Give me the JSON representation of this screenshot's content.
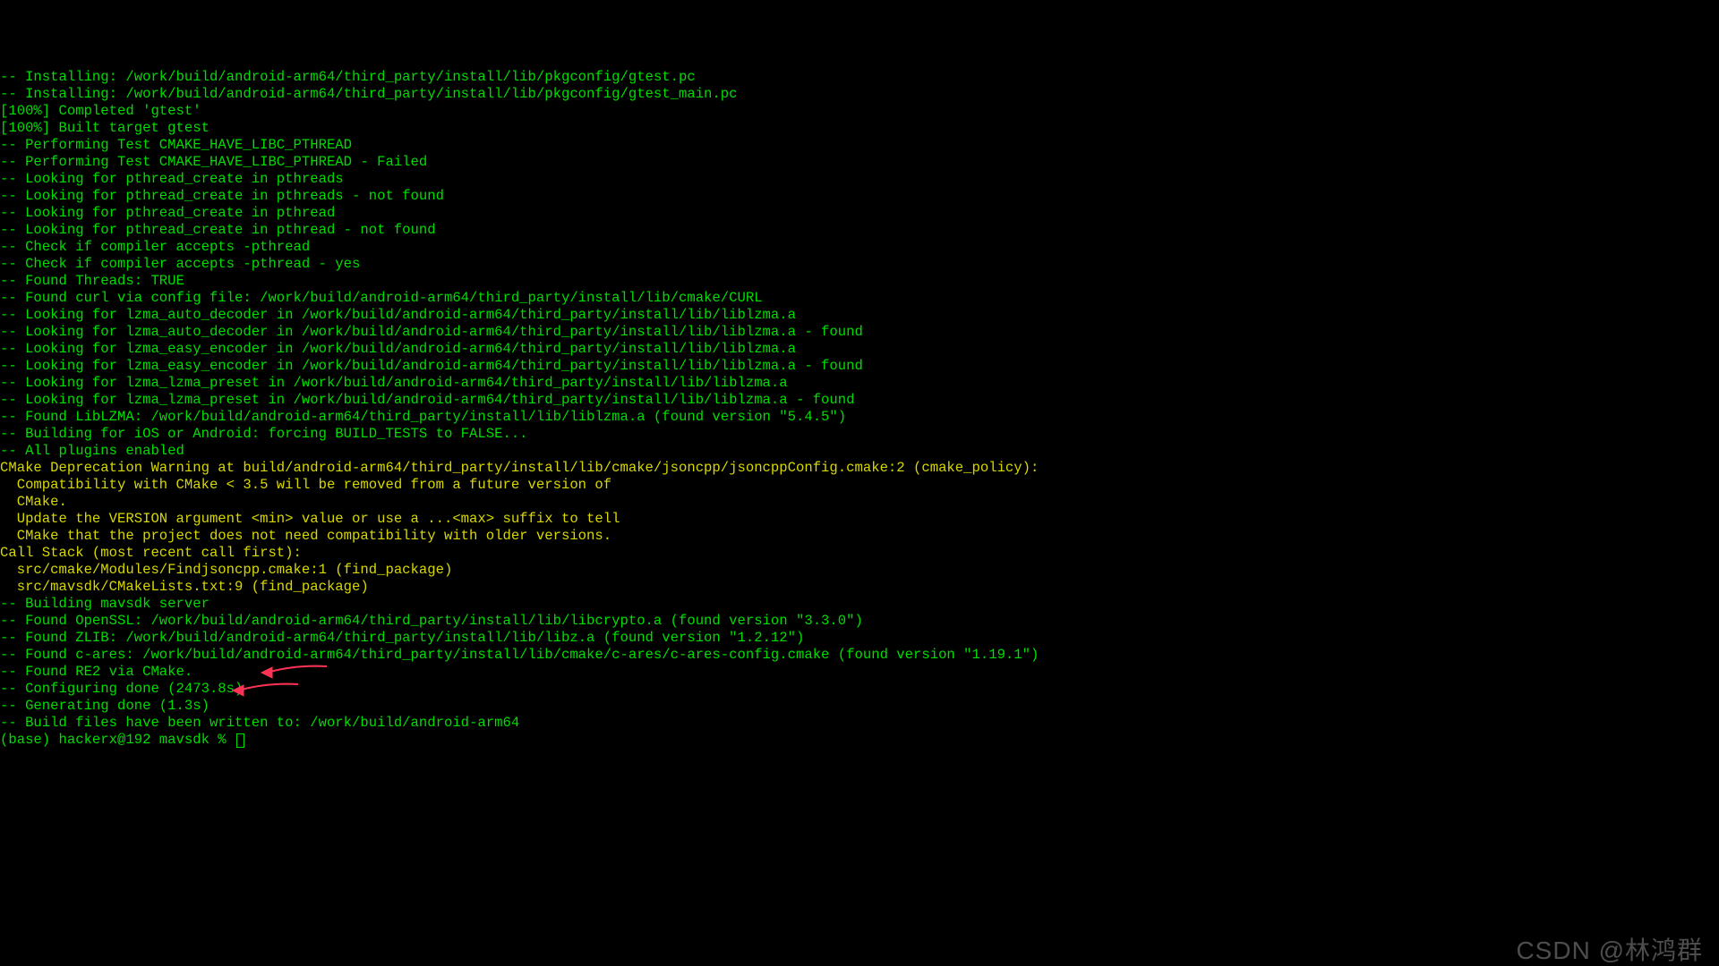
{
  "lines": [
    "-- Installing: /work/build/android-arm64/third_party/install/lib/pkgconfig/gtest.pc",
    "-- Installing: /work/build/android-arm64/third_party/install/lib/pkgconfig/gtest_main.pc",
    "[100%] Completed 'gtest'",
    "[100%] Built target gtest",
    "-- Performing Test CMAKE_HAVE_LIBC_PTHREAD",
    "-- Performing Test CMAKE_HAVE_LIBC_PTHREAD - Failed",
    "-- Looking for pthread_create in pthreads",
    "-- Looking for pthread_create in pthreads - not found",
    "-- Looking for pthread_create in pthread",
    "-- Looking for pthread_create in pthread - not found",
    "-- Check if compiler accepts -pthread",
    "-- Check if compiler accepts -pthread - yes",
    "-- Found Threads: TRUE",
    "-- Found curl via config file: /work/build/android-arm64/third_party/install/lib/cmake/CURL",
    "-- Looking for lzma_auto_decoder in /work/build/android-arm64/third_party/install/lib/liblzma.a",
    "-- Looking for lzma_auto_decoder in /work/build/android-arm64/third_party/install/lib/liblzma.a - found",
    "-- Looking for lzma_easy_encoder in /work/build/android-arm64/third_party/install/lib/liblzma.a",
    "-- Looking for lzma_easy_encoder in /work/build/android-arm64/third_party/install/lib/liblzma.a - found",
    "-- Looking for lzma_lzma_preset in /work/build/android-arm64/third_party/install/lib/liblzma.a",
    "-- Looking for lzma_lzma_preset in /work/build/android-arm64/third_party/install/lib/liblzma.a - found",
    "-- Found LibLZMA: /work/build/android-arm64/third_party/install/lib/liblzma.a (found version \"5.4.5\")",
    "-- Building for iOS or Android: forcing BUILD_TESTS to FALSE...",
    "-- All plugins enabled"
  ],
  "warn": [
    "CMake Deprecation Warning at build/android-arm64/third_party/install/lib/cmake/jsoncpp/jsoncppConfig.cmake:2 (cmake_policy):",
    "  Compatibility with CMake < 3.5 will be removed from a future version of",
    "  CMake.",
    "",
    "  Update the VERSION argument <min> value or use a ...<max> suffix to tell",
    "  CMake that the project does not need compatibility with older versions.",
    "Call Stack (most recent call first):",
    "  src/cmake/Modules/Findjsoncpp.cmake:1 (find_package)",
    "  src/mavsdk/CMakeLists.txt:9 (find_package)",
    "",
    ""
  ],
  "post": [
    "-- Building mavsdk server",
    "-- Found OpenSSL: /work/build/android-arm64/third_party/install/lib/libcrypto.a (found version \"3.3.0\")",
    "-- Found ZLIB: /work/build/android-arm64/third_party/install/lib/libz.a (found version \"1.2.12\")",
    "-- Found c-ares: /work/build/android-arm64/third_party/install/lib/cmake/c-ares/c-ares-config.cmake (found version \"1.19.1\")",
    "-- Found RE2 via CMake.",
    "-- Configuring done (2473.8s)",
    "-- Generating done (1.3s)",
    "-- Build files have been written to: /work/build/android-arm64"
  ],
  "prompt": "(base) hackerx@192 mavsdk % ",
  "watermark": "CSDN @林鸿群"
}
